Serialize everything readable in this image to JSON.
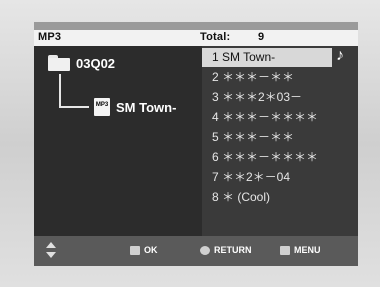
{
  "header": {
    "mode": "MP3",
    "total_label": "Total:",
    "total_value": "9"
  },
  "tree": {
    "folder": "03Q02",
    "file": "SM Town-",
    "file_icon_text": "MP3"
  },
  "tracks": [
    "1  SM Town-",
    "2  ＊＊＊－＊＊",
    "3  ＊＊＊2＊03－",
    "4  ＊＊＊－＊＊＊＊",
    "5  ＊＊＊－＊＊",
    "6  ＊＊＊－＊＊＊＊",
    "7  ＊＊2＊－04",
    "8  ＊ (Cool)"
  ],
  "footer": {
    "ok": "OK",
    "return": "RETURN",
    "menu": "MENU"
  },
  "icons": {
    "playing": "music-note",
    "nav": "updown-arrow"
  }
}
